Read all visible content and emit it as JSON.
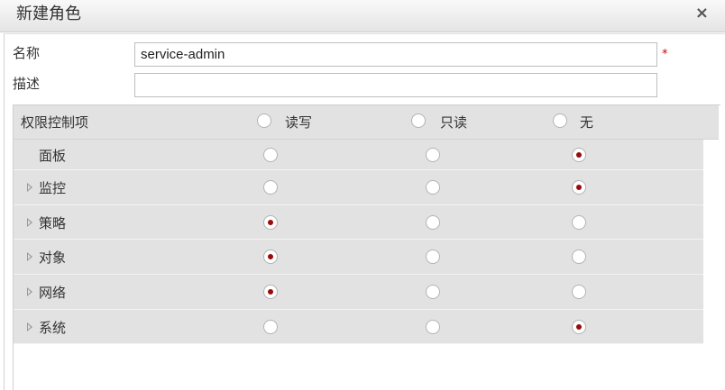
{
  "dialog": {
    "title": "新建角色",
    "close_label": "×"
  },
  "form": {
    "name_label": "名称",
    "name_value": "service-admin",
    "required_mark": "*",
    "desc_label": "描述",
    "desc_value": ""
  },
  "permissions": {
    "header": {
      "title": "权限控制项",
      "options": [
        "读写",
        "只读",
        "无"
      ],
      "selected": null
    },
    "rows": [
      {
        "label": "面板",
        "expandable": false,
        "selected": "无"
      },
      {
        "label": "监控",
        "expandable": true,
        "selected": "无"
      },
      {
        "label": "策略",
        "expandable": true,
        "selected": "读写"
      },
      {
        "label": "对象",
        "expandable": true,
        "selected": "读写"
      },
      {
        "label": "网络",
        "expandable": true,
        "selected": "读写"
      },
      {
        "label": "系统",
        "expandable": true,
        "selected": "无"
      }
    ]
  },
  "colors": {
    "radio_selected": "#9a0b0b",
    "required": "#d00000",
    "row_bg": "#e2e2e2"
  },
  "icons": {
    "close": "close-icon",
    "expand": "expand-triangle-icon"
  }
}
